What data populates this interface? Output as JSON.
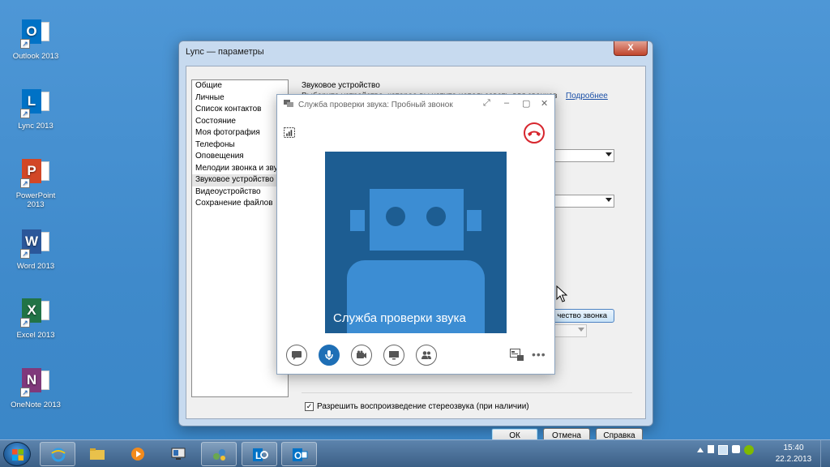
{
  "desktop_icons": [
    {
      "label": "Outlook 2013",
      "letter": "O",
      "color": "#0072c6"
    },
    {
      "label": "Lync 2013",
      "letter": "L",
      "color": "#0072c6"
    },
    {
      "label": "PowerPoint 2013",
      "letter": "P",
      "color": "#d24726"
    },
    {
      "label": "Word 2013",
      "letter": "W",
      "color": "#2b579a"
    },
    {
      "label": "Excel 2013",
      "letter": "X",
      "color": "#217346"
    },
    {
      "label": "OneNote 2013",
      "letter": "N",
      "color": "#80397b"
    }
  ],
  "options_dialog": {
    "title": "Lync — параметры",
    "close_glyph": "X",
    "nav_items": [
      "Общие",
      "Личные",
      "Список контактов",
      "Состояние",
      "Моя фотография",
      "Телефоны",
      "Оповещения",
      "Мелодии звонка и звук",
      "Звуковое устройство",
      "Видеоустройство",
      "Сохранение файлов"
    ],
    "selected_nav": "Звуковое устройство",
    "section_title": "Звуковое устройство",
    "description": "Выберите устройство, которое вы хотите использовать для звонков",
    "more_link": "Подробнее",
    "call_quality_button": "чество звонка",
    "stereo_checkbox": {
      "label": "Разрешить воспроизведение стереозвука (при наличии)",
      "checked": true,
      "mark": "✓"
    },
    "buttons": {
      "ok": "ОК",
      "cancel": "Отмена",
      "help": "Справка"
    }
  },
  "call_window": {
    "title": "Служба проверки звука: Пробный звонок",
    "window_controls": [
      "⤢",
      "–",
      "▢",
      "✕"
    ],
    "video_label": "Служба проверки звука",
    "controls": [
      "chat",
      "microphone",
      "video",
      "present",
      "participants"
    ],
    "more": "•••"
  },
  "taskbar": {
    "time": "15:40",
    "date": "22.2.2013",
    "apps": [
      "Internet Explorer",
      "Windows Explorer",
      "Media Player",
      "Remote Desktop",
      "Network",
      "Lync",
      "Outlook"
    ]
  },
  "colors": {
    "desktop": "#3f8acb",
    "lync_accent": "#1e6fb6",
    "video_bg": "#1d5d92",
    "robot": "#3c8dd3",
    "hangup": "#d7262e"
  }
}
